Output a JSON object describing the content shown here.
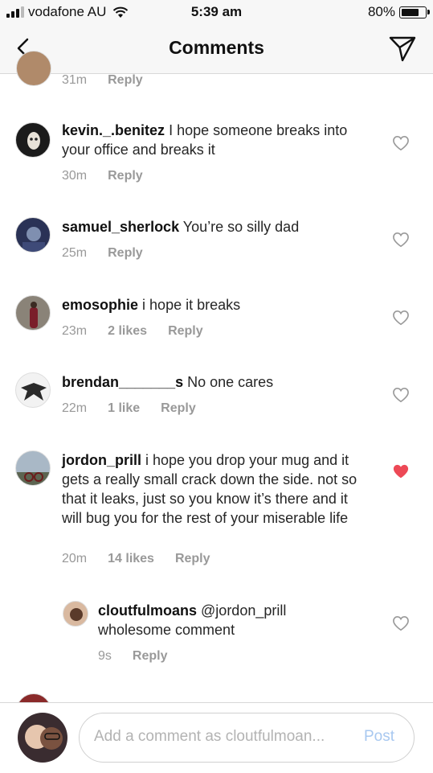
{
  "status_bar": {
    "carrier": "vodafone AU",
    "time": "5:39 am",
    "battery_percent": "80%",
    "battery_level": 0.8
  },
  "header": {
    "title": "Comments",
    "back_icon": "chevron-left-icon",
    "direct_icon": "paper-plane-icon"
  },
  "comments": [
    {
      "username": "",
      "text": "",
      "time": "31m",
      "likes": "",
      "reply": "Reply"
    },
    {
      "username": "kevin._.benitez",
      "text": "I hope someone breaks into your office and breaks it",
      "time": "30m",
      "likes": "",
      "reply": "Reply",
      "liked": false
    },
    {
      "username": "samuel_sherlock",
      "text": "You’re so silly dad",
      "time": "25m",
      "likes": "",
      "reply": "Reply",
      "liked": false
    },
    {
      "username": "emosophie",
      "text": "i hope it breaks",
      "time": "23m",
      "likes": "2 likes",
      "reply": "Reply",
      "liked": false
    },
    {
      "username": "brendan_______s",
      "text": "No one cares",
      "time": "22m",
      "likes": "1 like",
      "reply": "Reply",
      "liked": false
    },
    {
      "username": "jordon_prill",
      "text": "i hope you drop your mug and it gets a really small crack down the side. not so that it leaks, just so you know it’s there and it will bug you for the rest of your miserable life",
      "time": "20m",
      "likes": "14 likes",
      "reply": "Reply",
      "liked": true
    },
    {
      "username": "cloutfulmoans",
      "text": "@jordon_prill wholesome comment",
      "time": "9s",
      "likes": "",
      "reply": "Reply",
      "liked": false
    }
  ],
  "composer": {
    "placeholder": "Add a comment as cloutfulmoan...",
    "post_label": "Post"
  },
  "colors": {
    "liked_heart": "#ed4956",
    "post_disabled": "#a8c8f0",
    "meta_gray": "#999999"
  }
}
